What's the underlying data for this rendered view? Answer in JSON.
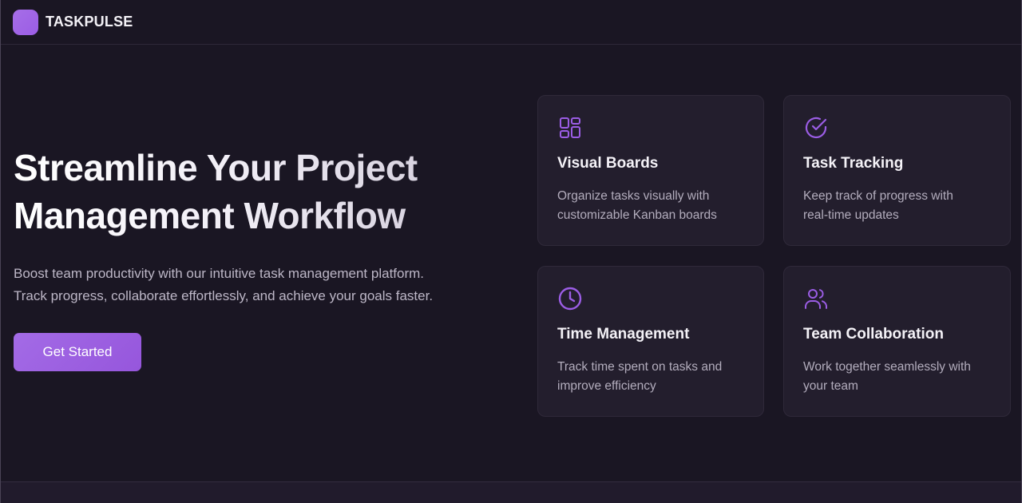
{
  "navbar": {
    "brand": "TASKPULSE",
    "logo_icon": "taskpulse-logo-icon"
  },
  "hero": {
    "title_line1": "Streamline Your Project",
    "title_line2": "Management Workflow",
    "subtitle_line1": "Boost team productivity with our intuitive task management platform.",
    "subtitle_line2": "Track progress, collaborate effortlessly, and achieve your goals faster.",
    "cta_label": "Get Started"
  },
  "features": [
    {
      "icon": "layout-grid-icon",
      "title": "Visual Boards",
      "desc_line1": "Organize tasks visually with",
      "desc_line2": "customizable Kanban boards"
    },
    {
      "icon": "check-circle-icon",
      "title": "Task Tracking",
      "desc_line1": "Keep track of progress with",
      "desc_line2": "real-time updates"
    },
    {
      "icon": "clock-icon",
      "title": "Time Management",
      "desc_line1": "Track time spent on tasks and",
      "desc_line2": "improve efficiency"
    },
    {
      "icon": "users-icon",
      "title": "Team Collaboration",
      "desc_line1": "Work together seamlessly with",
      "desc_line2": "your team"
    }
  ],
  "colors": {
    "background": "#1a1623",
    "card": "#231e2d",
    "accent": "#9b5de5",
    "text_muted": "#b3adbd"
  }
}
